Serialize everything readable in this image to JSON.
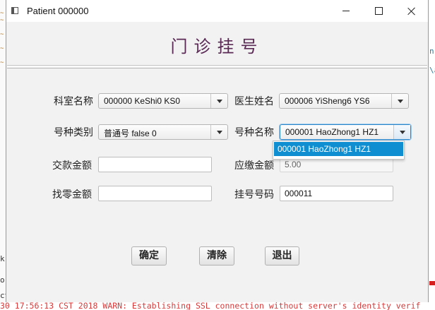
{
  "window": {
    "title": "Patient 000000"
  },
  "form": {
    "heading": "门诊挂号",
    "department": {
      "label": "科室名称",
      "value": "000000 KeShi0 KS0"
    },
    "doctor": {
      "label": "医生姓名",
      "value": "000006 YiSheng6 YS6"
    },
    "reg_category": {
      "label": "号种类别",
      "value": "普通号  false 0"
    },
    "reg_type": {
      "label": "号种名称",
      "value": "000001 HaoZhong1 HZ1",
      "options": [
        "000001 HaoZhong1 HZ1"
      ]
    },
    "paid_amount": {
      "label": "交款金额",
      "value": ""
    },
    "amount_due": {
      "label": "应缴金额",
      "value": "5.00"
    },
    "change_amount": {
      "label": "找零金额",
      "value": ""
    },
    "reg_number": {
      "label": "挂号号码",
      "value": "000011"
    }
  },
  "buttons": {
    "confirm": "确定",
    "clear": "清除",
    "exit": "退出"
  },
  "background": {
    "log_line": "30 17:56:13 CST 2018 WARN: Establishing SSL connection without server's identity verif",
    "right_fragment_1": "n",
    "right_fragment_2": "\\a",
    "left_fragment_1": "k",
    "left_fragment_2": "o",
    "left_fragment_3": "ct"
  },
  "colors": {
    "heading": "#5a2a55",
    "selection": "#0f8fd1",
    "focus": "#2d86c8",
    "log": "#d93a3a"
  }
}
